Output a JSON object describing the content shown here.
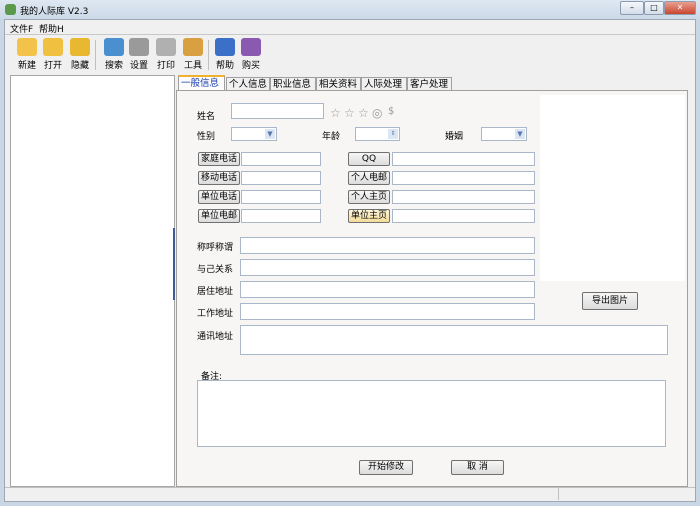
{
  "window": {
    "title": "我的人际库 V2.3",
    "minimize": "–",
    "maximize": "□",
    "close": "✕"
  },
  "menu": [
    {
      "label": "文件F"
    },
    {
      "label": "帮助H"
    }
  ],
  "toolbar": [
    {
      "label": "新建",
      "icon": "folder-new-icon",
      "color": "#f2c24a"
    },
    {
      "label": "打开",
      "icon": "folder-open-icon",
      "color": "#f0c040"
    },
    {
      "label": "隐藏",
      "icon": "lock-icon",
      "color": "#e8b830"
    },
    {
      "label": "搜索",
      "icon": "search-icon",
      "color": "#4a90d0"
    },
    {
      "label": "设置",
      "icon": "gear-icon",
      "color": "#9a9a9a"
    },
    {
      "label": "打印",
      "icon": "printer-icon",
      "color": "#b0b0b0"
    },
    {
      "label": "工具",
      "icon": "wrench-icon",
      "color": "#d8a040"
    },
    {
      "label": "帮助",
      "icon": "help-icon",
      "color": "#3a70c8"
    },
    {
      "label": "购买",
      "icon": "cart-icon",
      "color": "#8a5ab0"
    }
  ],
  "tabs": [
    {
      "label": "一般信息",
      "active": true
    },
    {
      "label": "个人信息"
    },
    {
      "label": "职业信息"
    },
    {
      "label": "相关资料"
    },
    {
      "label": "人际处理"
    },
    {
      "label": "客户处理"
    }
  ],
  "form": {
    "name_label": "姓名",
    "name_value": "",
    "gender_label": "性别",
    "age_label": "年龄",
    "marriage_label": "婚姻",
    "contact_buttons_left": [
      "家庭电话",
      "移动电话",
      "单位电话",
      "单位电邮"
    ],
    "contact_buttons_right": [
      "QQ",
      "个人电邮",
      "个人主页",
      "单位主页"
    ],
    "fields": [
      "称呼称谓",
      "与己关系",
      "居住地址",
      "工作地址"
    ],
    "mail_address_label": "通讯地址",
    "notes_label": "备注:",
    "export_image": "导出图片",
    "start_edit": "开始修改",
    "cancel": "取 消"
  }
}
